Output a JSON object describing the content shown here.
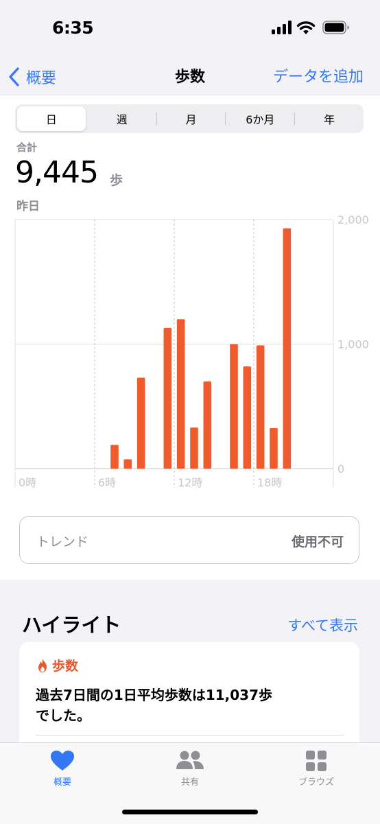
{
  "status": {
    "time": "6:35"
  },
  "nav": {
    "back_label": "概要",
    "title": "歩数",
    "add_data": "データを追加"
  },
  "segments": [
    "日",
    "週",
    "月",
    "6か月",
    "年"
  ],
  "summary": {
    "label": "合計",
    "value": "9,445",
    "unit": "歩",
    "date": "昨日"
  },
  "trend": {
    "label": "トレンド",
    "status": "使用不可"
  },
  "highlights": {
    "title": "ハイライト",
    "see_all": "すべて表示",
    "card": {
      "category": "歩数",
      "text_line1": "過去7日間の1日平均歩数は11,037歩",
      "text_line2": "でした。"
    }
  },
  "tabs": [
    {
      "label": "概要",
      "icon": "heart-icon",
      "active": true
    },
    {
      "label": "共有",
      "icon": "people-icon",
      "active": false
    },
    {
      "label": "ブラウズ",
      "icon": "grid-icon",
      "active": false
    }
  ],
  "colors": {
    "accent": "#3478f6",
    "bar": "#ef5b2c"
  },
  "chart_data": {
    "type": "bar",
    "x_unit": "hour",
    "x_tick_labels": [
      "0時",
      "6時",
      "12時",
      "18時"
    ],
    "x_tick_values": [
      0,
      6,
      12,
      18
    ],
    "y_tick_labels": [
      "2,000",
      "1,000",
      "0"
    ],
    "ylim": [
      0,
      2000
    ],
    "bars": [
      {
        "hour": 7,
        "value": 190
      },
      {
        "hour": 8,
        "value": 75
      },
      {
        "hour": 9,
        "value": 730
      },
      {
        "hour": 11,
        "value": 1130
      },
      {
        "hour": 12,
        "value": 1200
      },
      {
        "hour": 13,
        "value": 330
      },
      {
        "hour": 14,
        "value": 700
      },
      {
        "hour": 16,
        "value": 1000
      },
      {
        "hour": 17,
        "value": 820
      },
      {
        "hour": 18,
        "value": 990
      },
      {
        "hour": 19,
        "value": 325
      },
      {
        "hour": 20,
        "value": 1930
      }
    ]
  }
}
